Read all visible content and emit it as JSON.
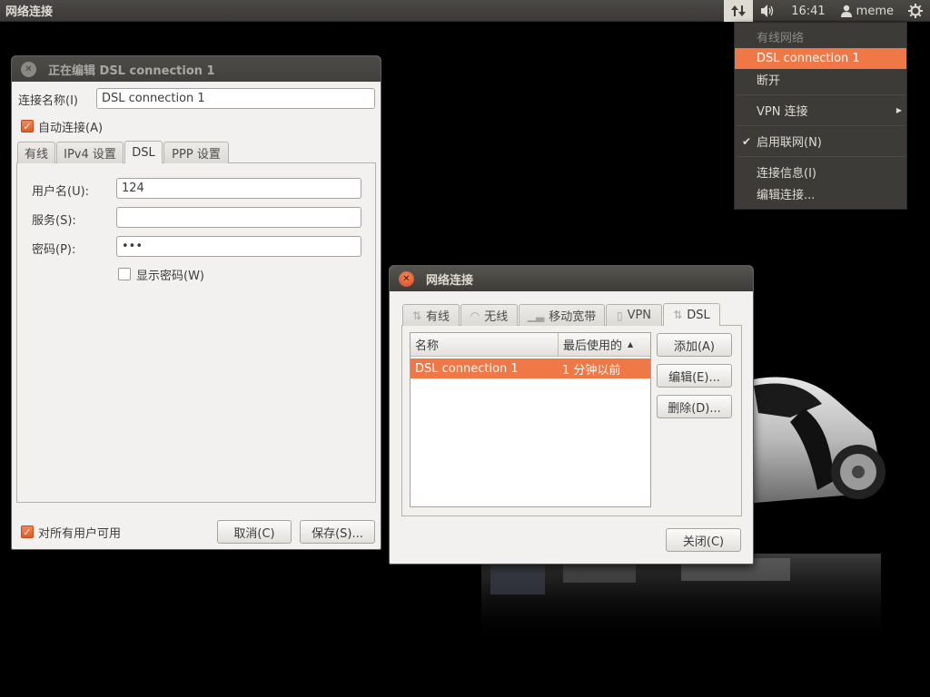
{
  "top_panel": {
    "title": "网络连接",
    "clock": "16:41",
    "user": "meme"
  },
  "network_menu": {
    "header": "有线网络",
    "selected": "DSL connection 1",
    "disconnect": "断开",
    "vpn": "VPN 连接",
    "enable_network": "启用联网(N)",
    "connection_info": "连接信息(I)",
    "edit_connections": "编辑连接..."
  },
  "editor_window": {
    "title": "正在编辑 DSL connection 1",
    "name_label": "连接名称(I)",
    "name_value": "DSL connection 1",
    "auto_connect": "自动连接(A)",
    "tabs": [
      "有线",
      "IPv4 设置",
      "DSL",
      "PPP 设置"
    ],
    "username_label": "用户名(U):",
    "username_value": "124",
    "service_label": "服务(S):",
    "service_value": "",
    "password_label": "密码(P):",
    "password_value": "•••",
    "show_password": "显示密码(W)",
    "all_users": "对所有用户可用",
    "cancel": "取消(C)",
    "save": "保存(S)..."
  },
  "connections_window": {
    "title": "网络连接",
    "tabs": [
      "有线",
      "无线",
      "移动宽带",
      "VPN",
      "DSL"
    ],
    "columns": [
      "名称",
      "最后使用的"
    ],
    "rows": [
      {
        "name": "DSL connection 1",
        "last_used": "1 分钟以前"
      }
    ],
    "add": "添加(A)",
    "edit": "编辑(E)...",
    "delete": "删除(D)...",
    "close": "关闭(C)"
  },
  "colors": {
    "accent": "#f07746",
    "panel": "#3c3b37",
    "window_bg": "#f2f1f0"
  }
}
